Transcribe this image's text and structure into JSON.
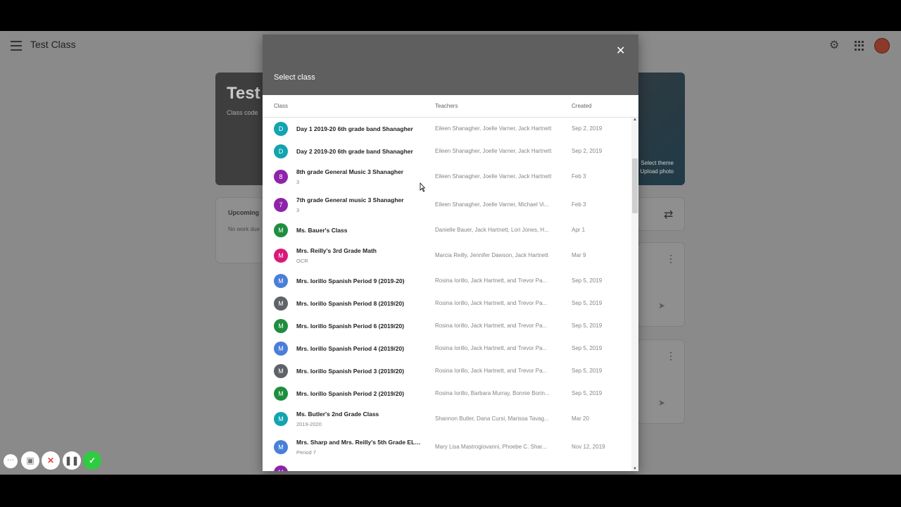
{
  "app": {
    "title": "Test Class"
  },
  "banner": {
    "title": "Test",
    "code_label": "Class code",
    "select_theme": "Select theme",
    "upload_photo": "Upload photo"
  },
  "upcoming": {
    "title": "Upcoming",
    "empty": "No work due"
  },
  "dialog": {
    "title": "Select class",
    "columns": {
      "class": "Class",
      "teachers": "Teachers",
      "created": "Created"
    },
    "rows": [
      {
        "letter": "D",
        "color": "#12a4af",
        "name": "Day 1 2019-20 6th grade band Shanagher",
        "sub": "",
        "teachers": "Eileen Shanagher, Joelle Varner, Jack Hartnett",
        "created": "Sep 2, 2019"
      },
      {
        "letter": "D",
        "color": "#12a4af",
        "name": "Day 2 2019-20 6th grade band Shanagher",
        "sub": "",
        "teachers": "Eileen Shanagher, Joelle Varner, Jack Hartnett",
        "created": "Sep 2, 2019"
      },
      {
        "letter": "8",
        "color": "#8e24aa",
        "name": "8th grade General Music 3 Shanagher",
        "sub": "3",
        "teachers": "Eileen Shanagher, Joelle Varner, Jack Hartnett",
        "created": "Feb 3"
      },
      {
        "letter": "7",
        "color": "#8e24aa",
        "name": "7th grade General music 3 Shanagher",
        "sub": "3",
        "teachers": "Eileen Shanagher, Joelle Varner, Michael Vi...",
        "created": "Feb 3"
      },
      {
        "letter": "M",
        "color": "#1e8e3e",
        "name": "Ms. Bauer's Class",
        "sub": "",
        "teachers": "Danielle Bauer, Jack Hartnett, Lori Jones, H...",
        "created": "Apr 1"
      },
      {
        "letter": "M",
        "color": "#d81b7a",
        "name": "Mrs. Reilly's 3rd Grade Math",
        "sub": "OCR",
        "teachers": "Marcia Reilly, Jennifer Dawson, Jack Hartnett",
        "created": "Mar 9"
      },
      {
        "letter": "M",
        "color": "#4a7fd9",
        "name": "Mrs. Iorillo Spanish Period 9 (2019-20)",
        "sub": "",
        "teachers": "Rosina Iorillo, Jack Hartnett, and Trevor Pa...",
        "created": "Sep 5, 2019"
      },
      {
        "letter": "M",
        "color": "#5f6368",
        "name": "Mrs. Iorillo Spanish Period 8 (2019/20)",
        "sub": "",
        "teachers": "Rosina Iorillo, Jack Hartnett, and Trevor Pa...",
        "created": "Sep 5, 2019"
      },
      {
        "letter": "M",
        "color": "#1e8e3e",
        "name": "Mrs. Iorillo Spanish Period 6 (2019/20)",
        "sub": "",
        "teachers": "Rosina Iorillo, Jack Hartnett, and Trevor Pa...",
        "created": "Sep 5, 2019"
      },
      {
        "letter": "M",
        "color": "#4a7fd9",
        "name": "Mrs. Iorillo Spanish Period 4 (2019/20)",
        "sub": "",
        "teachers": "Rosina Iorillo, Jack Hartnett, and Trevor Pa...",
        "created": "Sep 5, 2019"
      },
      {
        "letter": "M",
        "color": "#5f6368",
        "name": "Mrs. Iorillo Spanish Period 3 (2019/20)",
        "sub": "",
        "teachers": "Rosina Iorillo, Jack Hartnett, and Trevor Pa...",
        "created": "Sep 5, 2019"
      },
      {
        "letter": "M",
        "color": "#1e8e3e",
        "name": "Mrs. Iorillo Spanish Period 2 (2019/20)",
        "sub": "",
        "teachers": "Rosina Iorillo, Barbara Murray, Bonnie Borin...",
        "created": "Sep 5, 2019"
      },
      {
        "letter": "M",
        "color": "#12a4af",
        "name": "Ms. Butler's 2nd Grade Class",
        "sub": "2019-2020",
        "teachers": "Shannon Butler, Dana Cursi, Marissa Tavag...",
        "created": "Mar 20"
      },
      {
        "letter": "M",
        "color": "#4a7fd9",
        "name": "Mrs. Sharp and Mrs. Reilly's 5th Grade ELA ...",
        "sub": "Period 7",
        "teachers": "Mary Lisa Mastrogiovanni, Phoebe C. Shar...",
        "created": "Nov 12, 2019"
      },
      {
        "letter": "M",
        "color": "#8e24aa",
        "name": "",
        "sub": "",
        "teachers": "",
        "created": ""
      }
    ]
  },
  "icons": {
    "menu": "menu-icon",
    "settings": "gear-icon",
    "apps": "apps-grid-icon",
    "close": "close-icon"
  }
}
